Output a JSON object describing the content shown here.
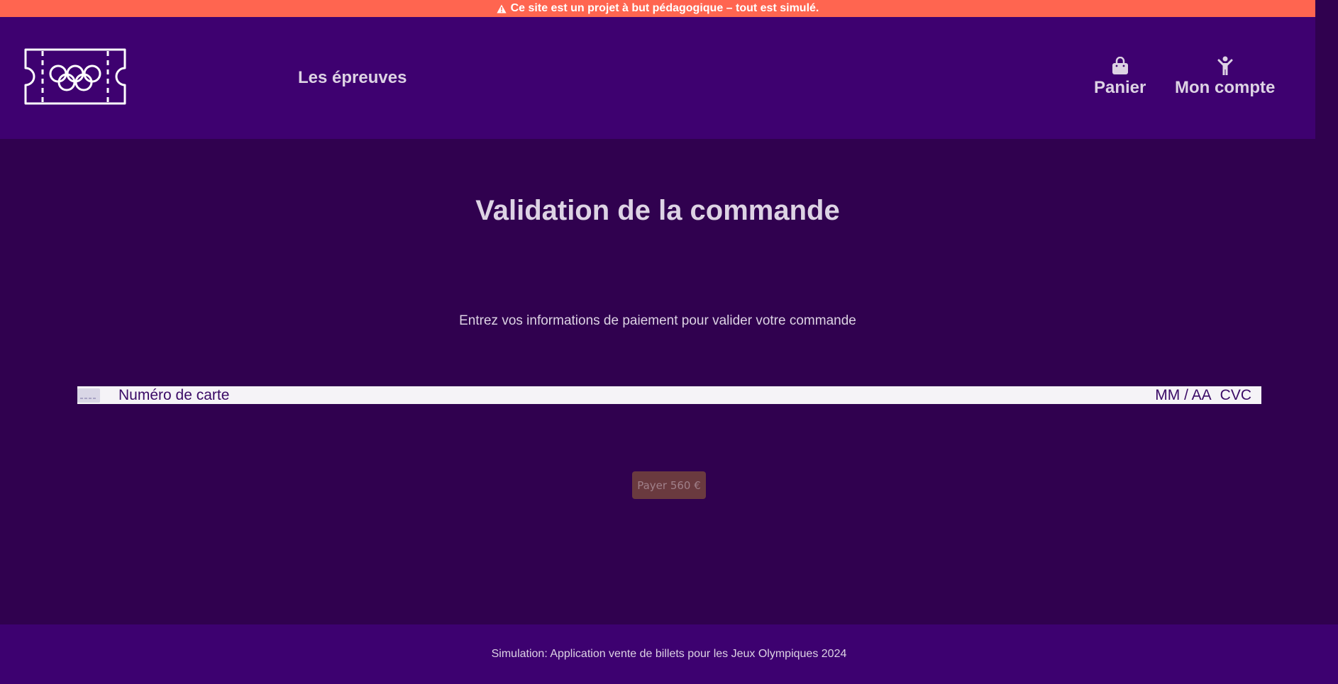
{
  "banner": {
    "text": "Ce site est un projet à but pédagogique – tout est simulé.",
    "icon": "warning-icon",
    "background": "#ff6550"
  },
  "header": {
    "logo": "olympic-ticket-logo",
    "nav_events": "Les épreuves",
    "cart": {
      "label": "Panier",
      "icon": "shopping-bag-icon"
    },
    "account": {
      "label": "Mon compte",
      "icon": "person-icon"
    },
    "background": "#3e0170"
  },
  "main": {
    "title": "Validation de la commande",
    "subtitle": "Entrez vos informations de paiement pour valider votre commande",
    "card_form": {
      "card_icon": "credit-card-icon",
      "number_placeholder": "Numéro de carte",
      "expiry_placeholder": "MM / AA",
      "cvc_placeholder": "CVC"
    },
    "pay_button": "Payer 560 €",
    "background": "#30014f"
  },
  "footer": {
    "text": "Simulation: Application vente de billets pour les Jeux Olympiques 2024"
  }
}
